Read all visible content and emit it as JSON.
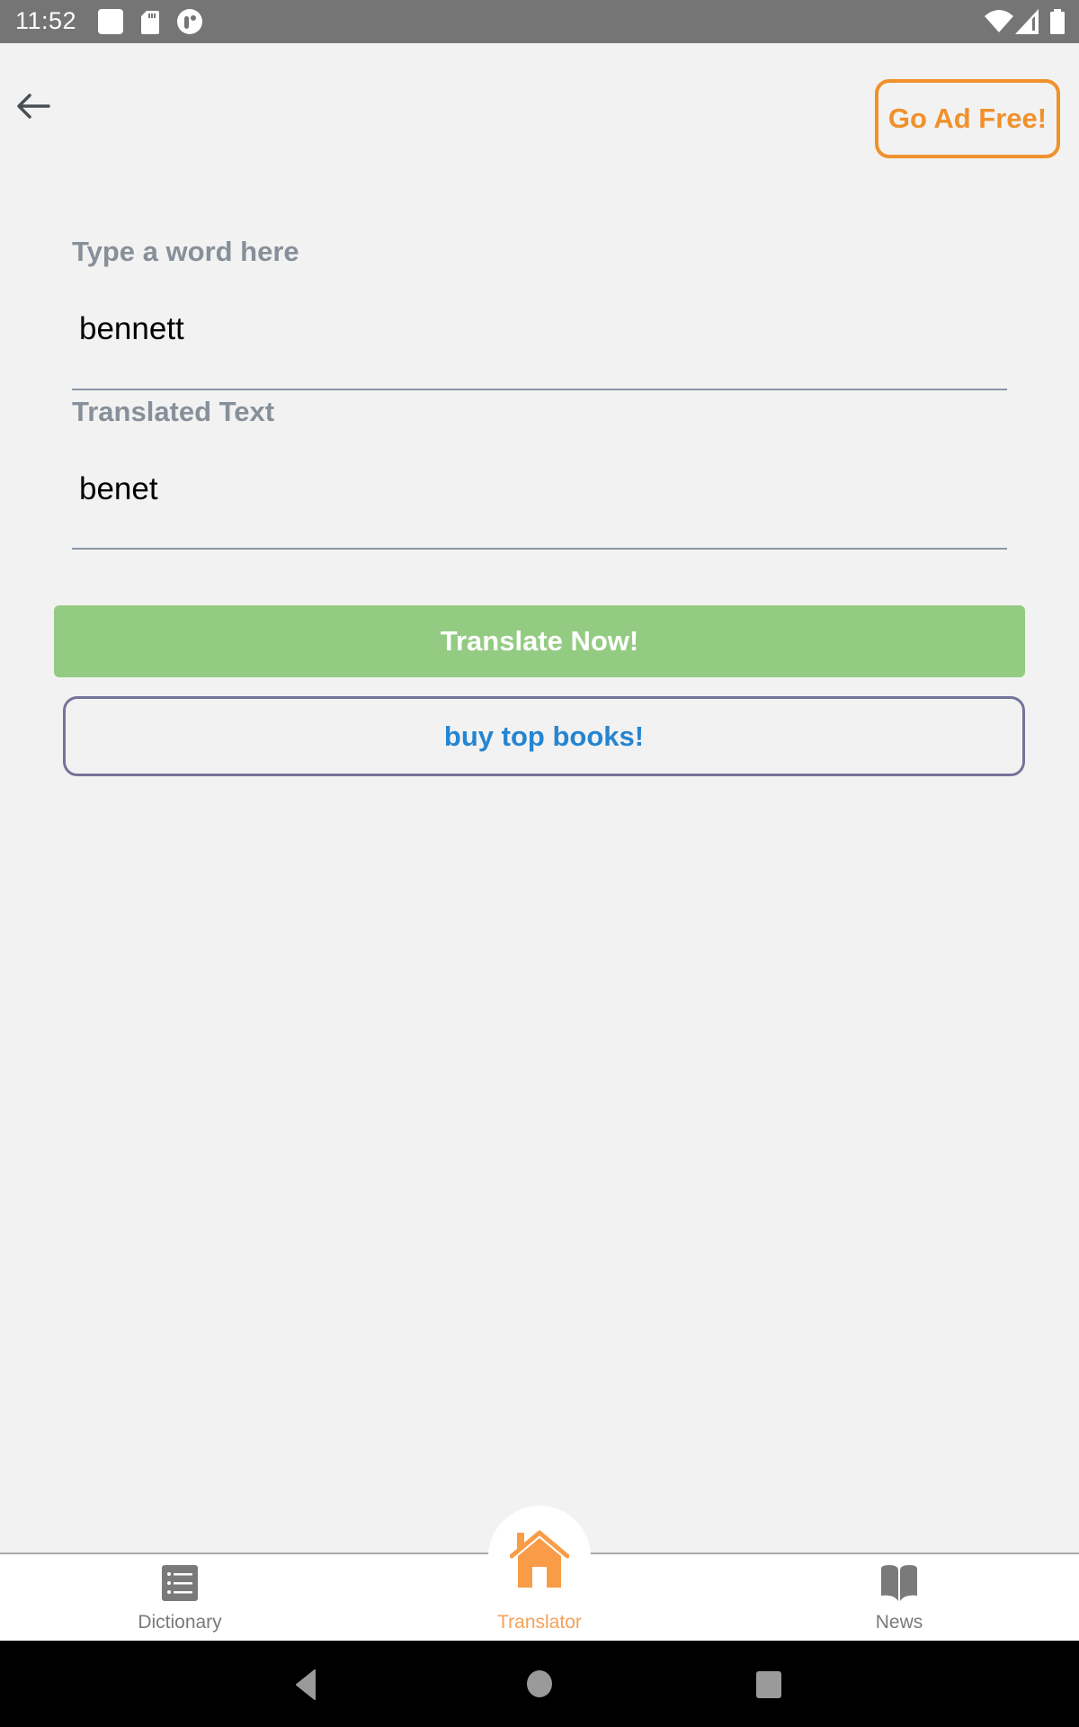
{
  "status_bar": {
    "time": "11:52",
    "icons": [
      "notification-square-icon",
      "sd-card-icon",
      "app-notification-icon",
      "wifi-icon",
      "cell-signal-icon",
      "battery-icon"
    ]
  },
  "header": {
    "back_icon": "arrow-left-icon",
    "ad_free_label": "Go Ad Free!"
  },
  "form": {
    "word_field": {
      "label": "Type a word here",
      "value": "bennett"
    },
    "translated_field": {
      "label": "Translated Text",
      "value": "benet"
    }
  },
  "buttons": {
    "translate_label": "Translate Now!",
    "books_label": "buy top books!"
  },
  "bottom_nav": {
    "items": [
      {
        "label": "Dictionary",
        "icon": "list-icon",
        "active": false
      },
      {
        "label": "Translator",
        "icon": "home-icon",
        "active": true
      },
      {
        "label": "News",
        "icon": "book-open-icon",
        "active": false
      }
    ]
  },
  "system_nav": {
    "buttons": [
      "back",
      "home",
      "recents"
    ]
  },
  "colors": {
    "accent_orange": "#f0912c",
    "active_nav": "#f5a059",
    "translate_green": "#94cb82",
    "books_border": "#75739a",
    "books_text": "#2585d1",
    "label_gray": "#87909a"
  }
}
